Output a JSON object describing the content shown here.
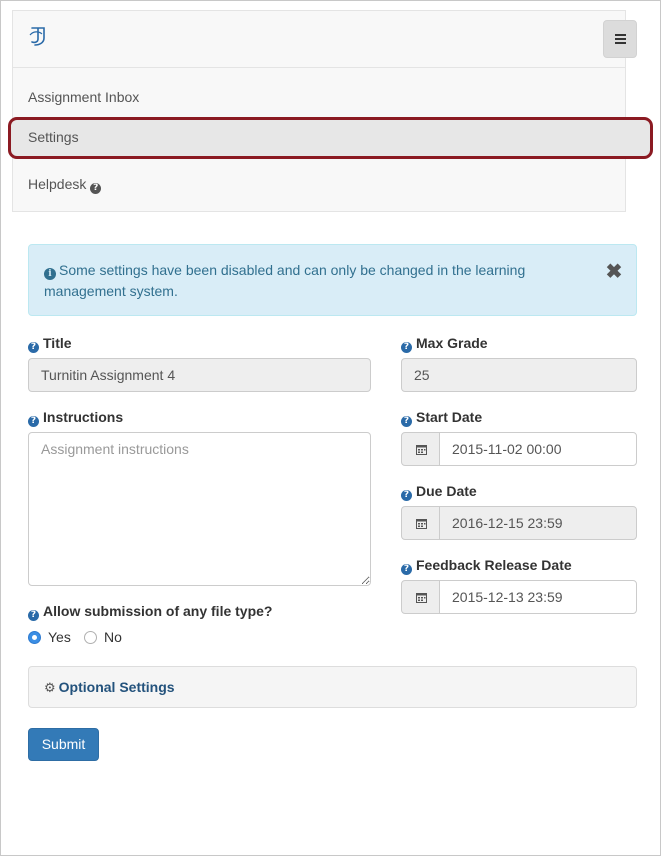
{
  "nav": {
    "items": [
      {
        "label": "Assignment Inbox"
      },
      {
        "label": "Settings"
      },
      {
        "label": "Helpdesk"
      }
    ]
  },
  "alert": {
    "message": "Some settings have been disabled and can only be changed in the learning management system.",
    "close_glyph": "✖"
  },
  "form": {
    "title": {
      "label": "Title",
      "value": "Turnitin Assignment 4"
    },
    "instructions": {
      "label": "Instructions",
      "placeholder": "Assignment instructions"
    },
    "file_type": {
      "label": "Allow submission of any file type?",
      "yes": "Yes",
      "no": "No",
      "selected": "Yes"
    },
    "max_grade": {
      "label": "Max Grade",
      "value": "25"
    },
    "start_date": {
      "label": "Start Date",
      "value": "2015-11-02 00:00"
    },
    "due_date": {
      "label": "Due Date",
      "value": "2016-12-15 23:59"
    },
    "feedback_date": {
      "label": "Feedback Release Date",
      "value": "2015-12-13 23:59"
    }
  },
  "optional_settings": {
    "label": "Optional Settings"
  },
  "submit": {
    "label": "Submit"
  },
  "icons": {
    "help": "question-circle-icon",
    "info": "info-circle-icon",
    "calendar": "calendar-icon",
    "gear": "gear-icon",
    "menu": "hamburger-menu-icon",
    "logo": "turnitin-logo-icon"
  },
  "colors": {
    "primary": "#337ab7",
    "alert_bg": "#d9edf7",
    "alert_text": "#31708f",
    "highlight": "#8b1a22"
  }
}
